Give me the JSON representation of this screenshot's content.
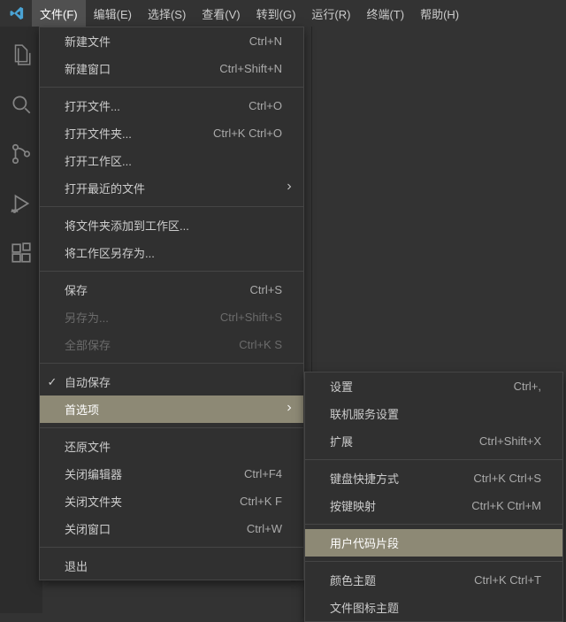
{
  "menubar": {
    "items": [
      {
        "label": "文件(F)",
        "active": true
      },
      {
        "label": "编辑(E)"
      },
      {
        "label": "选择(S)"
      },
      {
        "label": "查看(V)"
      },
      {
        "label": "转到(G)"
      },
      {
        "label": "运行(R)"
      },
      {
        "label": "终端(T)"
      },
      {
        "label": "帮助(H)"
      }
    ]
  },
  "activity": {
    "icons": [
      "files-icon",
      "search-icon",
      "source-control-icon",
      "run-debug-icon",
      "extensions-icon"
    ]
  },
  "file_menu": {
    "groups": [
      [
        {
          "label": "新建文件",
          "shortcut": "Ctrl+N"
        },
        {
          "label": "新建窗口",
          "shortcut": "Ctrl+Shift+N"
        }
      ],
      [
        {
          "label": "打开文件...",
          "shortcut": "Ctrl+O"
        },
        {
          "label": "打开文件夹...",
          "shortcut": "Ctrl+K Ctrl+O"
        },
        {
          "label": "打开工作区..."
        },
        {
          "label": "打开最近的文件",
          "arrow": true
        }
      ],
      [
        {
          "label": "将文件夹添加到工作区..."
        },
        {
          "label": "将工作区另存为..."
        }
      ],
      [
        {
          "label": "保存",
          "shortcut": "Ctrl+S"
        },
        {
          "label": "另存为...",
          "shortcut": "Ctrl+Shift+S",
          "disabled": true
        },
        {
          "label": "全部保存",
          "shortcut": "Ctrl+K S",
          "disabled": true
        }
      ],
      [
        {
          "label": "自动保存",
          "check": true
        },
        {
          "label": "首选项",
          "arrow": true,
          "highlight": true
        }
      ],
      [
        {
          "label": "还原文件"
        },
        {
          "label": "关闭编辑器",
          "shortcut": "Ctrl+F4"
        },
        {
          "label": "关闭文件夹",
          "shortcut": "Ctrl+K F"
        },
        {
          "label": "关闭窗口",
          "shortcut": "Ctrl+W"
        }
      ],
      [
        {
          "label": "退出"
        }
      ]
    ]
  },
  "pref_submenu": {
    "groups": [
      [
        {
          "label": "设置",
          "shortcut": "Ctrl+,"
        },
        {
          "label": "联机服务设置"
        },
        {
          "label": "扩展",
          "shortcut": "Ctrl+Shift+X"
        }
      ],
      [
        {
          "label": "键盘快捷方式",
          "shortcut": "Ctrl+K Ctrl+S"
        },
        {
          "label": "按键映射",
          "shortcut": "Ctrl+K Ctrl+M"
        }
      ],
      [
        {
          "label": "用户代码片段",
          "highlight": true
        }
      ],
      [
        {
          "label": "颜色主题",
          "shortcut": "Ctrl+K Ctrl+T"
        },
        {
          "label": "文件图标主题"
        }
      ]
    ]
  }
}
